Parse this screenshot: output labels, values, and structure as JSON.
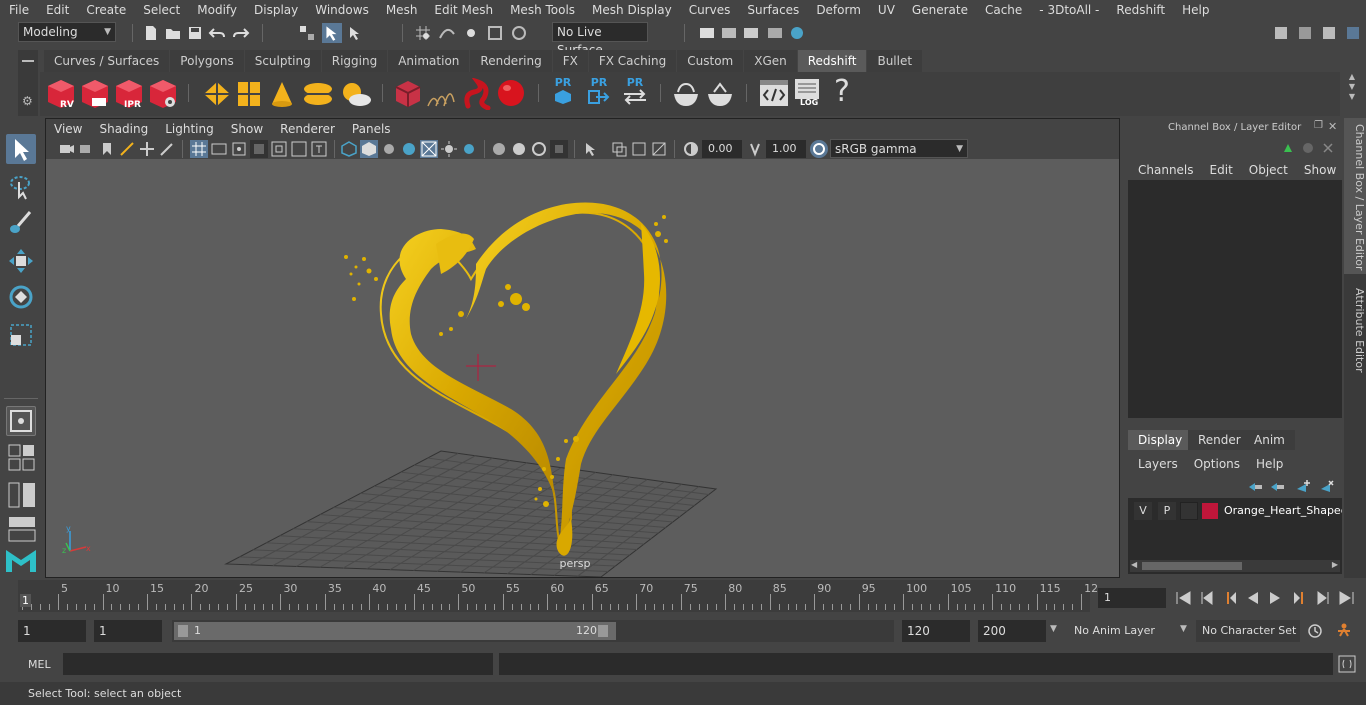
{
  "menu": [
    "File",
    "Edit",
    "Create",
    "Select",
    "Modify",
    "Display",
    "Windows",
    "Mesh",
    "Edit Mesh",
    "Mesh Tools",
    "Mesh Display",
    "Curves",
    "Surfaces",
    "Deform",
    "UV",
    "Generate",
    "Cache",
    "- 3DtoAll -",
    "Redshift",
    "Help"
  ],
  "status": {
    "mode": "Modeling",
    "live_surface": "No Live Surface"
  },
  "shelf_tabs": [
    "Curves / Surfaces",
    "Polygons",
    "Sculpting",
    "Rigging",
    "Animation",
    "Rendering",
    "FX",
    "FX Caching",
    "Custom",
    "XGen",
    "Redshift",
    "Bullet"
  ],
  "shelf_active": "Redshift",
  "shelf_labels": {
    "rv": "RV",
    "ipr": "IPR",
    "pr": "PR",
    "log": "LOG",
    "help": "?"
  },
  "viewport": {
    "menu": [
      "View",
      "Shading",
      "Lighting",
      "Show",
      "Renderer",
      "Panels"
    ],
    "exposure": "0.00",
    "gamma": "1.00",
    "color_space": "sRGB gamma",
    "camera": "persp"
  },
  "channel_box": {
    "title": "Channel Box / Layer Editor",
    "menu": [
      "Channels",
      "Edit",
      "Object",
      "Show"
    ]
  },
  "layer_editor": {
    "tabs": [
      "Display",
      "Render",
      "Anim"
    ],
    "active_tab": "Display",
    "menu": [
      "Layers",
      "Options",
      "Help"
    ],
    "layer": {
      "v": "V",
      "p": "P",
      "name": "Orange_Heart_Shaped",
      "color": "#c0163a"
    }
  },
  "side_tabs": [
    "Channel Box / Layer Editor",
    "Attribute Editor"
  ],
  "timeline": {
    "ticks": [
      "5",
      "10",
      "15",
      "20",
      "25",
      "30",
      "35",
      "40",
      "45",
      "50",
      "55",
      "60",
      "65",
      "70",
      "75",
      "80",
      "85",
      "90",
      "95",
      "100",
      "105",
      "110",
      "115",
      "12"
    ],
    "current_frame_marker": "1",
    "current_frame": "1"
  },
  "range": {
    "start": "1",
    "playback_start": "1",
    "slider_start": "1",
    "slider_end": "120",
    "playback_end": "120",
    "end": "200",
    "anim_layer": "No Anim Layer",
    "character_set": "No Character Set"
  },
  "command": {
    "lang": "MEL"
  },
  "help_line": "Select Tool: select an object",
  "colors": {
    "accent": "#5a7896",
    "liquid": "#e0b300",
    "layer": "#c0163a"
  }
}
